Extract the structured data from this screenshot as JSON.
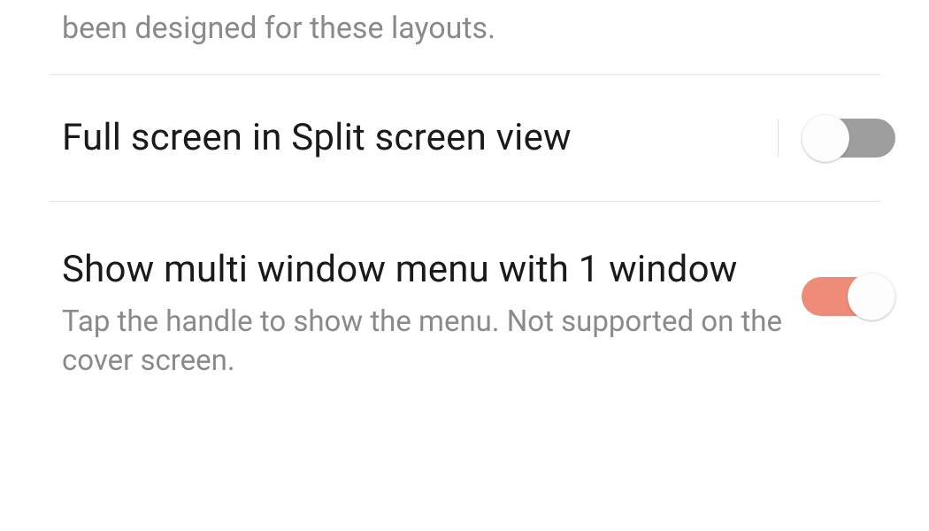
{
  "partial": {
    "desc_visible": "been designed for these layouts."
  },
  "item1": {
    "title": "Full screen in Split screen view",
    "on": false
  },
  "item2": {
    "title": "Show multi window menu with 1 window",
    "desc": "Tap the handle to show the menu. Not supported on the cover screen.",
    "on": true
  },
  "colors": {
    "accent_track_on": "#ee8c79",
    "track_off": "#9e9e9e"
  }
}
